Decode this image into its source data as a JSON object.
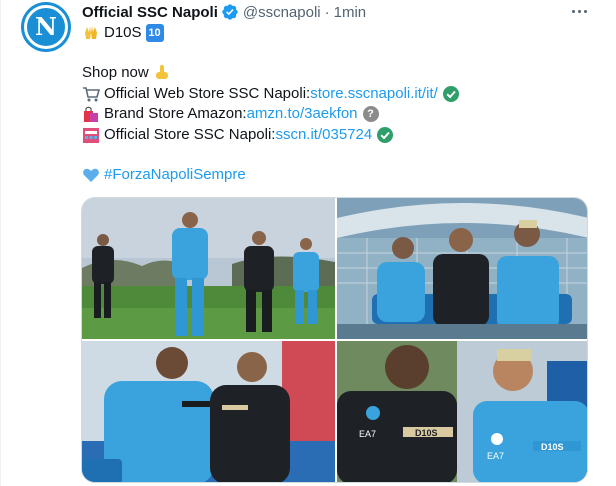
{
  "account": {
    "name": "Official SSC Napoli",
    "handle": "@sscnapoli",
    "separator": "·",
    "time": "1min",
    "avatar_letter": "N",
    "avatar_color": "#1a8fd6",
    "verified_icon": "verified-badge-icon"
  },
  "tweet": {
    "line1_text": "D10S",
    "line1_emoji": "raising-hands-icon",
    "line1_badge": "10",
    "shop_text": "Shop now",
    "shop_emoji": "pointing-down-icon",
    "stores": [
      {
        "icon": "shopping-cart-icon",
        "label": "Official Web Store SSC Napoli: ",
        "link": "store.sscnapoli.it/it/",
        "status_icon": "check-icon"
      },
      {
        "icon": "shopping-bags-icon",
        "label": "Brand Store Amazon: ",
        "link": "amzn.to/3aekfon",
        "status_icon": "question-icon",
        "status_glyph": "?"
      },
      {
        "icon": "department-store-icon",
        "label": "Official Store SSC Napoli: ",
        "link": "sscn.it/035724",
        "status_icon": "check-icon"
      }
    ],
    "hashtag": "#ForzaNapoliSempre",
    "hashtag_emoji": "blue-heart-icon"
  },
  "media": {
    "photos": [
      {
        "name": "photo-players-on-pitch"
      },
      {
        "name": "photo-players-on-bench"
      },
      {
        "name": "photo-two-players-dugout"
      },
      {
        "name": "photo-two-players-closeup"
      }
    ],
    "print_labels": {
      "d10s": "D10S",
      "ea7": "EA7"
    }
  },
  "colors": {
    "link": "#1d9bf0",
    "text": "#0f1419",
    "secondary": "#536471",
    "check_green": "#2e9e6b",
    "jersey_blue": "#3aa3dd"
  }
}
